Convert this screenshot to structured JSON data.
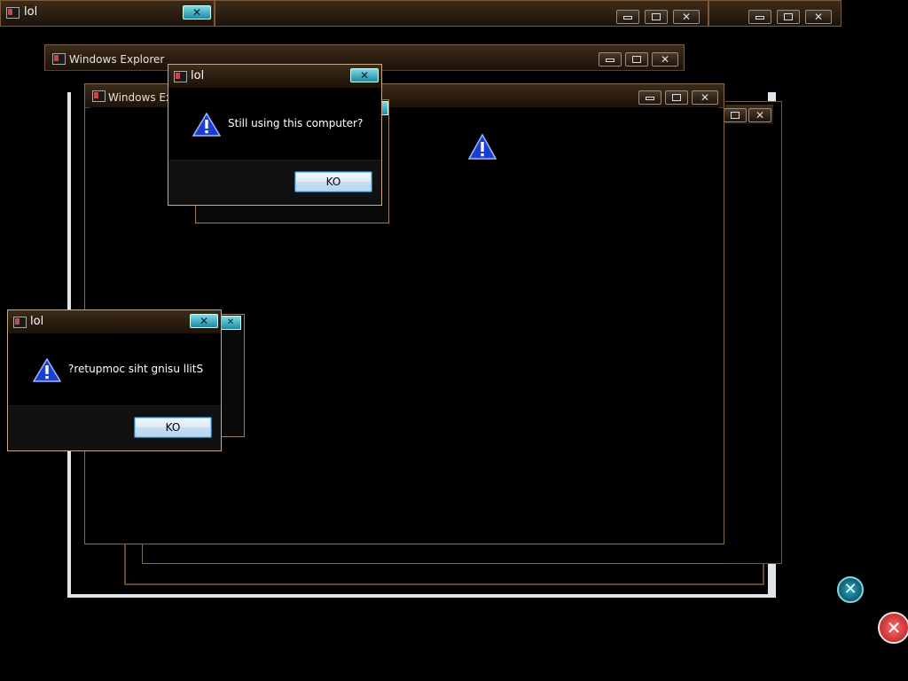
{
  "top_windows": {
    "lol_title": "lol"
  },
  "explorer_back": {
    "title": "Windows Explorer"
  },
  "explorer_front": {
    "title": "Windows Explorer"
  },
  "dialog_top": {
    "title": "lol",
    "message": "Still using this computer?",
    "ok_label": "KO"
  },
  "dialog_bottom": {
    "title": "lol",
    "message": "?retupmoc siht gnisu llitS",
    "ok_label": "KO"
  },
  "icons": {
    "warning": "warning-icon",
    "close": "close-icon"
  },
  "colors": {
    "frame": "#8b6a48",
    "titlebar": "#2a1c0f",
    "close_accent": "#1c8aa2",
    "warning_blue": "#1a3fd0"
  }
}
